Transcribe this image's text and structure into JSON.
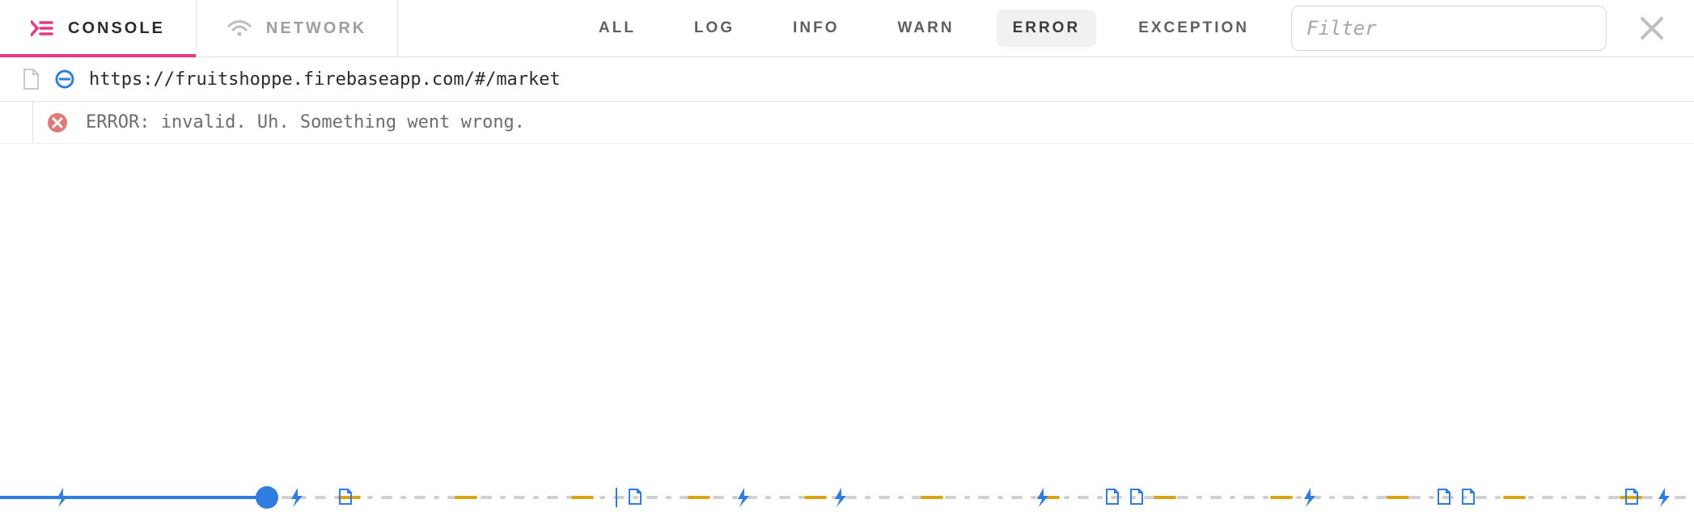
{
  "tabs": {
    "console": {
      "label": "CONSOLE",
      "active": true
    },
    "network": {
      "label": "NETWORK",
      "active": false
    }
  },
  "filters": [
    {
      "id": "all",
      "label": "ALL",
      "active": false
    },
    {
      "id": "log",
      "label": "LOG",
      "active": false
    },
    {
      "id": "info",
      "label": "INFO",
      "active": false
    },
    {
      "id": "warn",
      "label": "WARN",
      "active": false
    },
    {
      "id": "error",
      "label": "ERROR",
      "active": true
    },
    {
      "id": "exception",
      "label": "EXCEPTION",
      "active": false
    }
  ],
  "filter_input": {
    "placeholder": "Filter",
    "value": ""
  },
  "url_row": {
    "url": "https://fruitshoppe.firebaseapp.com/#/market"
  },
  "log": {
    "level": "error",
    "message": "ERROR: invalid. Uh. Something went wrong."
  },
  "colors": {
    "accent": "#e6397e",
    "link_blue": "#2f7de1",
    "warn_amber": "#d9a514",
    "error_red": "#d86a6a",
    "muted": "#9a9a9a"
  }
}
